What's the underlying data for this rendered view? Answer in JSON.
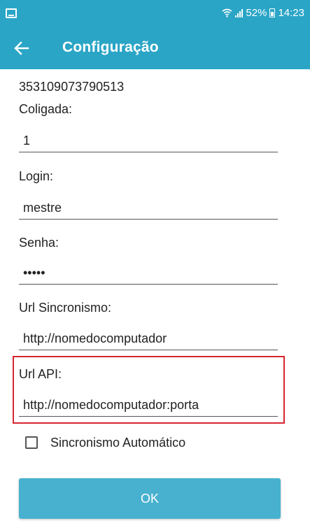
{
  "colors": {
    "primary": "#2aa5c6",
    "button": "#47b1cf",
    "highlight": "#d7262f"
  },
  "status_bar": {
    "left_icon": "screenshot-icon",
    "battery_percent": "52%",
    "time": "14:23"
  },
  "app_bar": {
    "back_icon": "arrow-left-icon",
    "title": "Configuração"
  },
  "device_id": "353109073790513",
  "fields": {
    "coligada": {
      "label": "Coligada:",
      "value": "1"
    },
    "login": {
      "label": "Login:",
      "value": "mestre"
    },
    "senha": {
      "label": "Senha:",
      "value": "•••••"
    },
    "url_sincronismo": {
      "label": "Url Sincronismo:",
      "value": "http://nomedocomputador"
    },
    "url_api": {
      "label": "Url API:",
      "value": "http://nomedocomputador:porta"
    }
  },
  "auto_sync": {
    "label": "Sincronismo Automático",
    "checked": false
  },
  "ok_button": {
    "label": "OK"
  }
}
